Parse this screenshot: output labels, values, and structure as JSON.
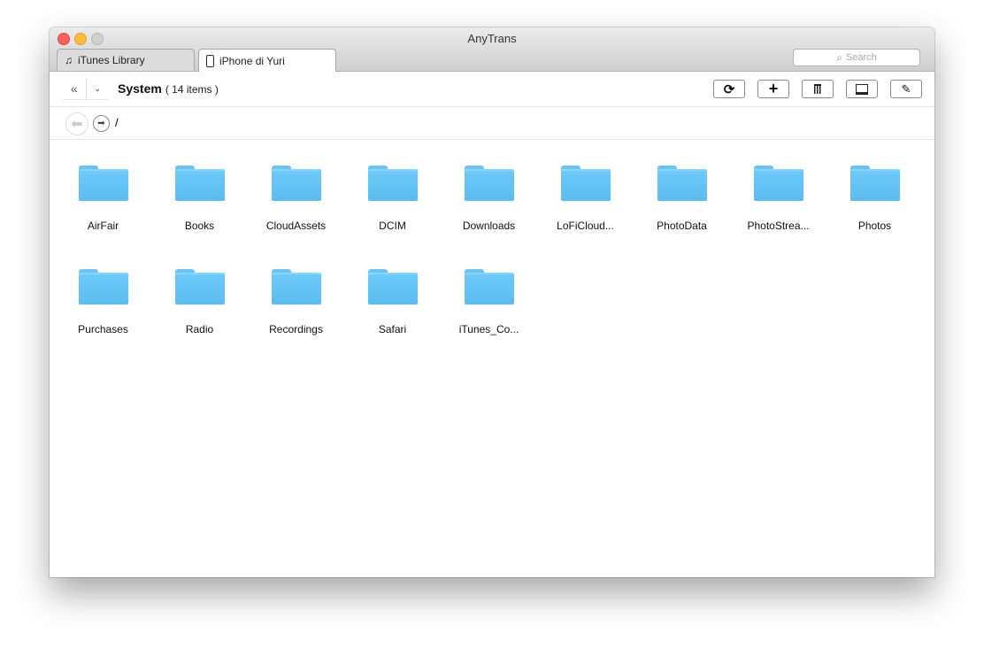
{
  "window": {
    "title": "AnyTrans"
  },
  "tabs": [
    {
      "label": "iTunes Library",
      "icon": "music-note-icon"
    },
    {
      "label": "iPhone di Yuri",
      "icon": "iphone-icon"
    }
  ],
  "search": {
    "placeholder": "Search"
  },
  "header": {
    "title": "System",
    "count": "( 14 items )"
  },
  "toolbar": {
    "buttons": [
      "refresh",
      "add",
      "delete",
      "to-computer",
      "edit"
    ]
  },
  "path": {
    "current": "/"
  },
  "folders": [
    "AirFair",
    "Books",
    "CloudAssets",
    "DCIM",
    "Downloads",
    "LoFiCloud...",
    "PhotoData",
    "PhotoStrea...",
    "Photos",
    "Purchases",
    "Radio",
    "Recordings",
    "Safari",
    "iTunes_Co..."
  ],
  "colors": {
    "folder": "#64c4f6",
    "close": "#fc605c",
    "minimize": "#fdbc40"
  }
}
